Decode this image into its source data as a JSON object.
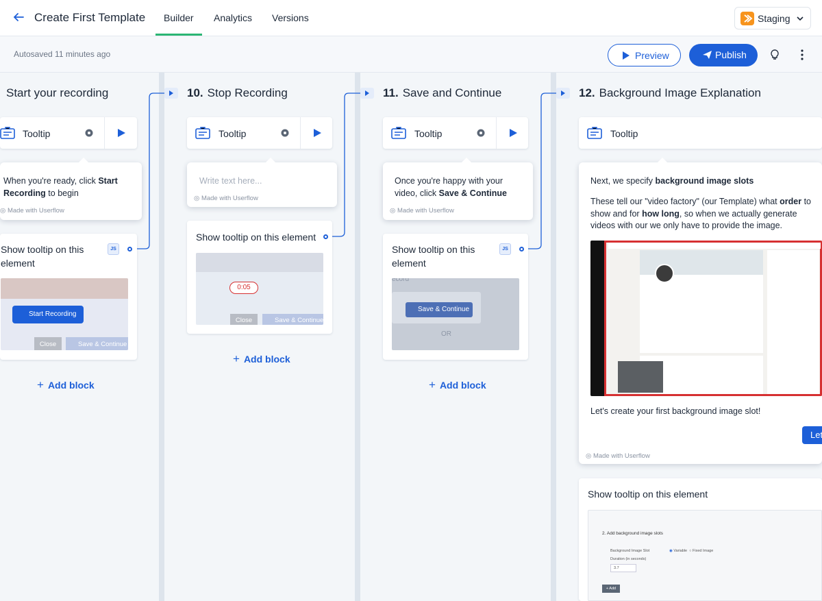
{
  "header": {
    "title": "Create First Template",
    "tabs": [
      {
        "label": "Builder",
        "active": true
      },
      {
        "label": "Analytics",
        "active": false
      },
      {
        "label": "Versions",
        "active": false
      }
    ],
    "environment": "Staging",
    "accent_color": "#2bb673"
  },
  "subbar": {
    "autosave": "Autosaved 11 minutes ago",
    "preview_label": "Preview",
    "publish_label": "Publish",
    "primary_color": "#1d5fd8"
  },
  "steps": [
    {
      "title": "Start your recording",
      "tooltip_label": "Tooltip",
      "bubble_text": "When you're ready, click",
      "bubble_bold": "Start Recording",
      "bubble_tail": "to begin",
      "made_with": "Made with Userflow",
      "show_label": "Show tooltip on this element",
      "js": "JS",
      "shot_button": "Start Recording",
      "shot_close": "Close",
      "shot_save": "Save & Continue",
      "add_block": "Add block"
    },
    {
      "number": "10.",
      "title": "Stop Recording",
      "tooltip_label": "Tooltip",
      "bubble_placeholder": "Write text here...",
      "made_with": "Made with Userflow",
      "show_label": "Show tooltip on this element",
      "shot_timer": "0:05",
      "shot_close": "Close",
      "shot_save": "Save & Continue",
      "add_block": "Add block"
    },
    {
      "number": "11.",
      "title": "Save and Continue",
      "tooltip_label": "Tooltip",
      "bubble_text": "Once you're happy with your video, click",
      "bubble_bold": "Save & Continue",
      "made_with": "Made with Userflow",
      "show_label": "Show tooltip on this element",
      "js": "JS",
      "shot_record": "Record Video",
      "shot_save": "Save & Continue",
      "shot_or": "OR",
      "shot_cord": "ecord",
      "add_block": "Add block"
    },
    {
      "number": "12.",
      "title": "Background Image Explanation",
      "tooltip_label": "Tooltip",
      "p1_text": "Next, we specify",
      "p1_bold": "background image slots",
      "p2_a": "These tell our \"video factory\" (our Template) what",
      "p2_b": "order",
      "p2_c": "to show and for",
      "p2_d": "how long",
      "p2_e": ", so when we actually generate videos with our we only have to provide the image.",
      "p3": "Let's create your first background image slot!",
      "cta": "Let",
      "made_with": "Made with Userflow",
      "show_label": "Show tooltip on this element",
      "shot_heading": "2. Add background image slots",
      "shot_slot_label": "Background Image Slot",
      "shot_variable": "Variable",
      "shot_fixed": "Fixed Image",
      "shot_duration": "Duration (in seconds)",
      "shot_duration_value": "3.7",
      "shot_add": "+ Add"
    }
  ]
}
